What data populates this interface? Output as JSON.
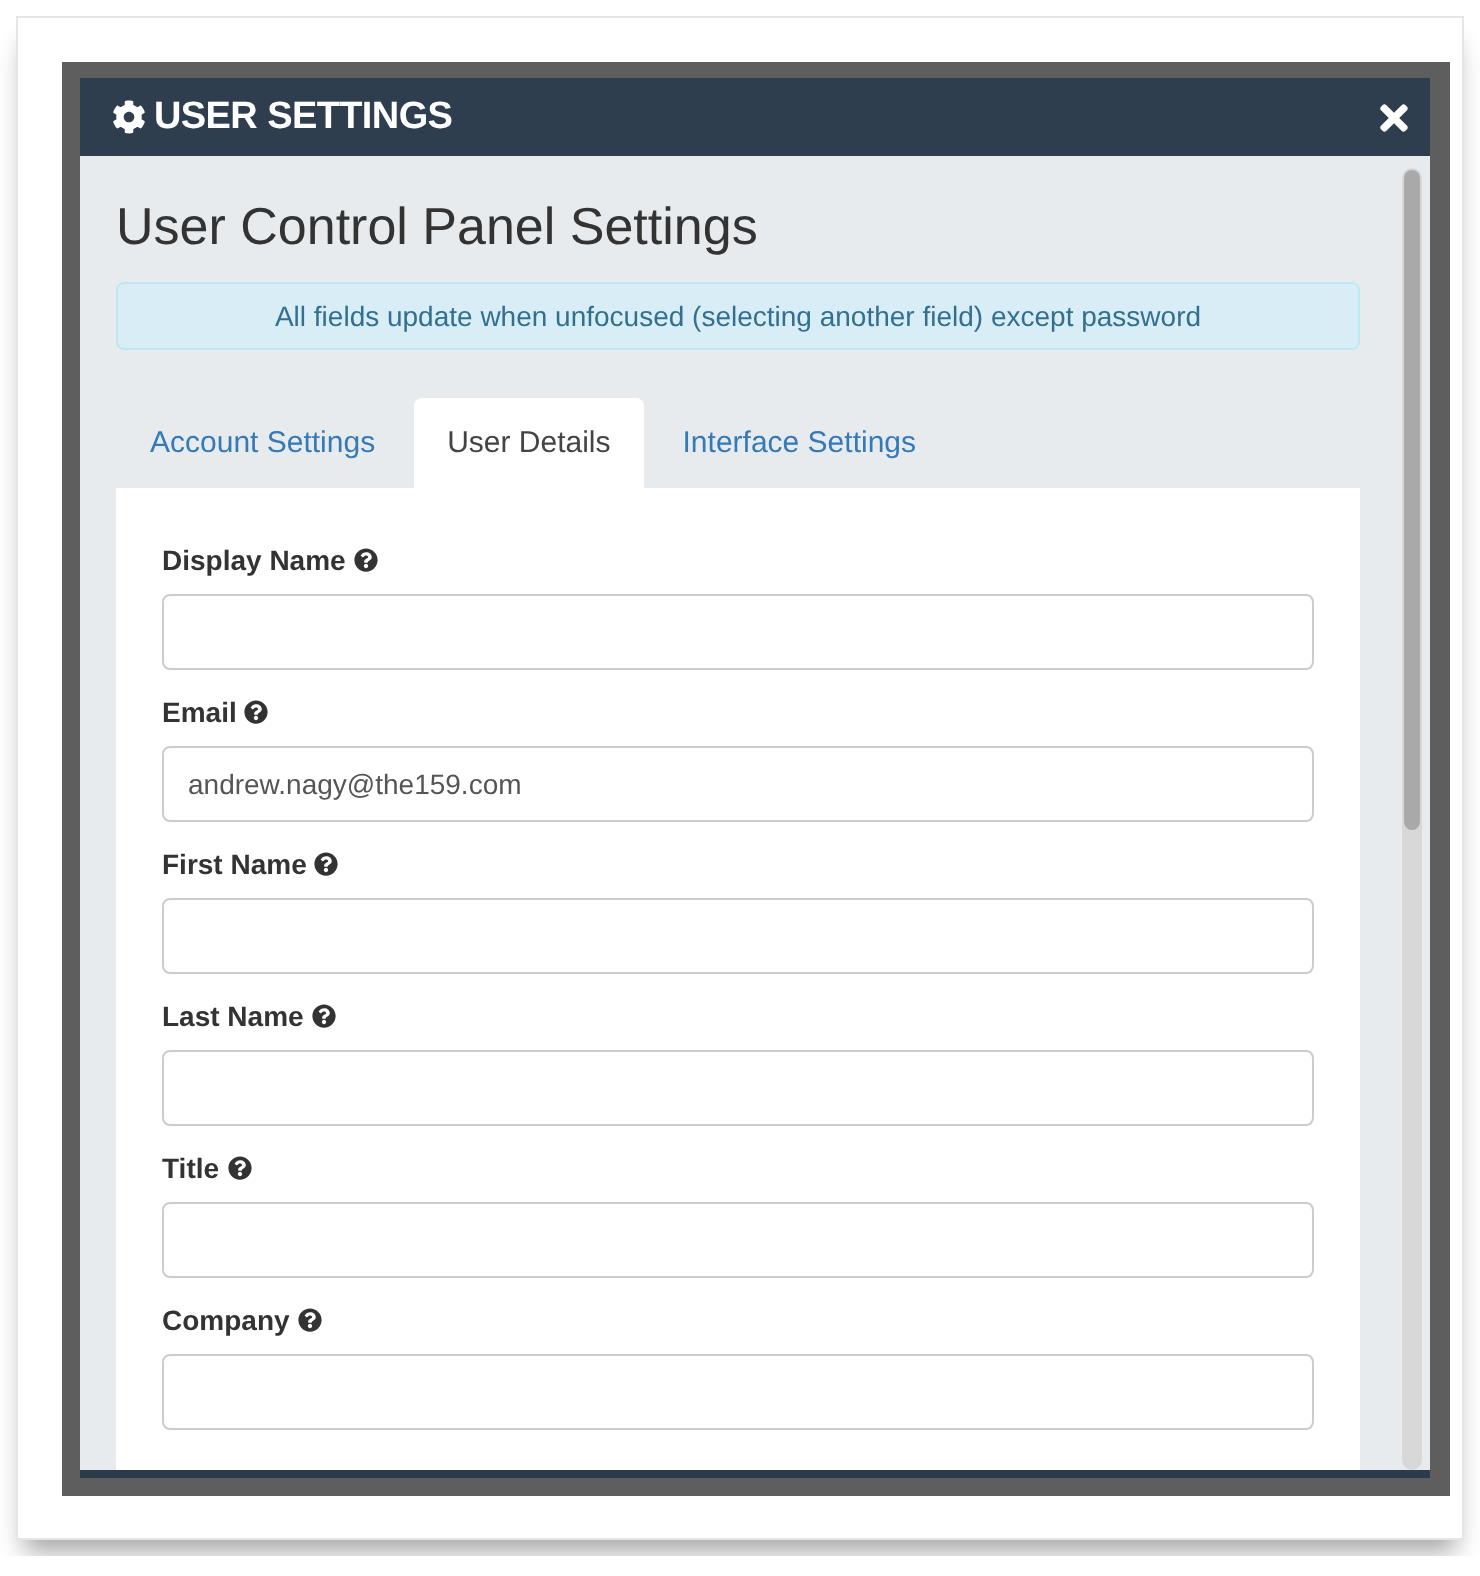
{
  "dialog": {
    "title": "USER SETTINGS",
    "heading": "User Control Panel Settings",
    "notice": "All fields update when unfocused (selecting another field) except password",
    "tabs": [
      {
        "label": "Account Settings",
        "selected": false
      },
      {
        "label": "User Details",
        "selected": true
      },
      {
        "label": "Interface Settings",
        "selected": false
      }
    ],
    "fields": [
      {
        "label": "Display Name"
      },
      {
        "label": "Email",
        "value": "andrew.nagy@the159.com"
      },
      {
        "label": "First Name"
      },
      {
        "label": "Last Name"
      },
      {
        "label": "Title"
      },
      {
        "label": "Company"
      }
    ]
  }
}
